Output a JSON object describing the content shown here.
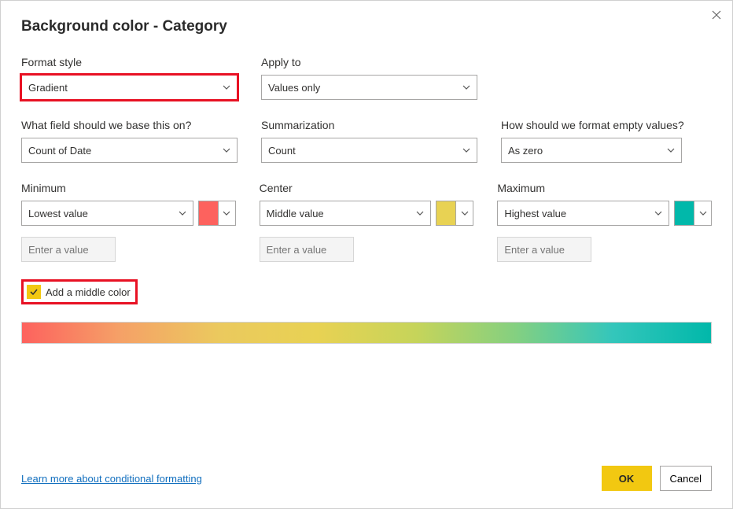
{
  "dialog": {
    "title": "Background color - Category"
  },
  "fields": {
    "formatStyle": {
      "label": "Format style",
      "value": "Gradient"
    },
    "applyTo": {
      "label": "Apply to",
      "value": "Values only"
    },
    "baseField": {
      "label": "What field should we base this on?",
      "value": "Count of Date"
    },
    "summarization": {
      "label": "Summarization",
      "value": "Count"
    },
    "emptyFormat": {
      "label": "How should we format empty values?",
      "value": "As zero"
    },
    "minimum": {
      "label": "Minimum",
      "value": "Lowest value",
      "placeholder": "Enter a value",
      "color": "#fd625e"
    },
    "center": {
      "label": "Center",
      "value": "Middle value",
      "placeholder": "Enter a value",
      "color": "#e8d253"
    },
    "maximum": {
      "label": "Maximum",
      "value": "Highest value",
      "placeholder": "Enter a value",
      "color": "#01b8aa"
    }
  },
  "checkbox": {
    "label": "Add a middle color",
    "checked": true
  },
  "footer": {
    "learnMore": "Learn more about conditional formatting",
    "ok": "OK",
    "cancel": "Cancel"
  }
}
